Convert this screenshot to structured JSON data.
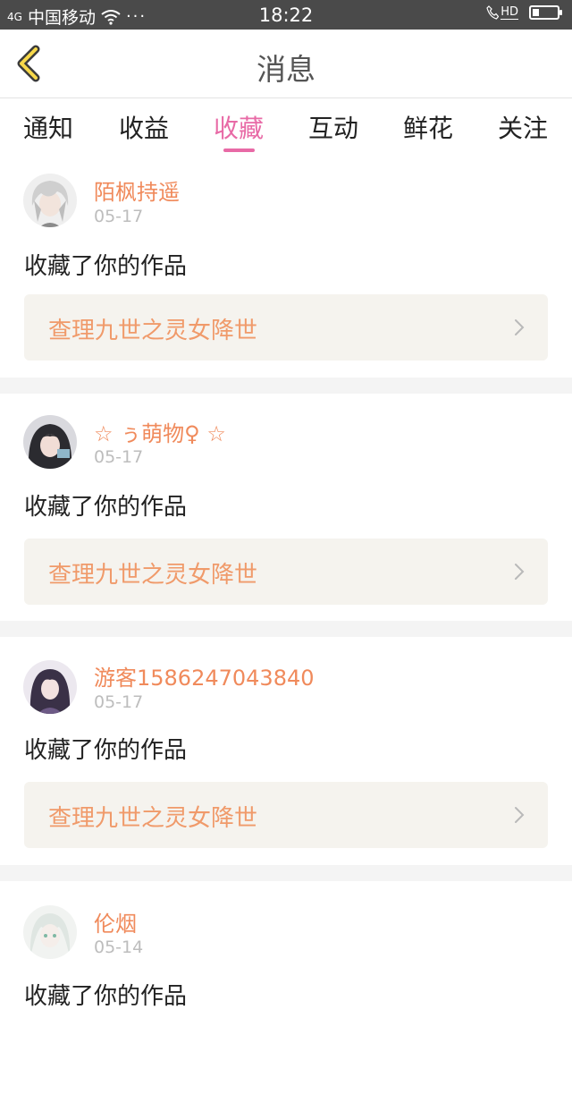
{
  "status_bar": {
    "signal": "4G",
    "carrier": "中国移动",
    "dots": "···",
    "time": "18:22",
    "hd": "HD",
    "battery_level": 0.25
  },
  "header": {
    "title": "消息",
    "back_icon": "chevron-left-icon"
  },
  "tabs": [
    {
      "label": "通知",
      "active": false
    },
    {
      "label": "收益",
      "active": false
    },
    {
      "label": "收藏",
      "active": true
    },
    {
      "label": "互动",
      "active": false
    },
    {
      "label": "鲜花",
      "active": false
    },
    {
      "label": "关注",
      "active": false
    }
  ],
  "colors": {
    "accent_pink": "#e86aa6",
    "username_orange": "#f08a5b",
    "work_title_orange": "#f09a6a",
    "work_box_bg": "#f5f3ee"
  },
  "items": [
    {
      "username": "陌枫持遥",
      "date": "05-17",
      "action": "收藏了你的作品",
      "work_title": "查理九世之灵女降世",
      "avatar": "avatar-silver-hair"
    },
    {
      "username": "☆ ぅ萌物♀ ☆",
      "date": "05-17",
      "action": "收藏了你的作品",
      "work_title": "查理九世之灵女降世",
      "avatar": "avatar-dark-hair"
    },
    {
      "username": "游客1586247043840",
      "date": "05-17",
      "action": "收藏了你的作品",
      "work_title": "查理九世之灵女降世",
      "avatar": "avatar-purple-hair"
    },
    {
      "username": "伦烟",
      "date": "05-14",
      "action": "收藏了你的作品",
      "work_title": "",
      "avatar": "avatar-white-hair"
    }
  ]
}
